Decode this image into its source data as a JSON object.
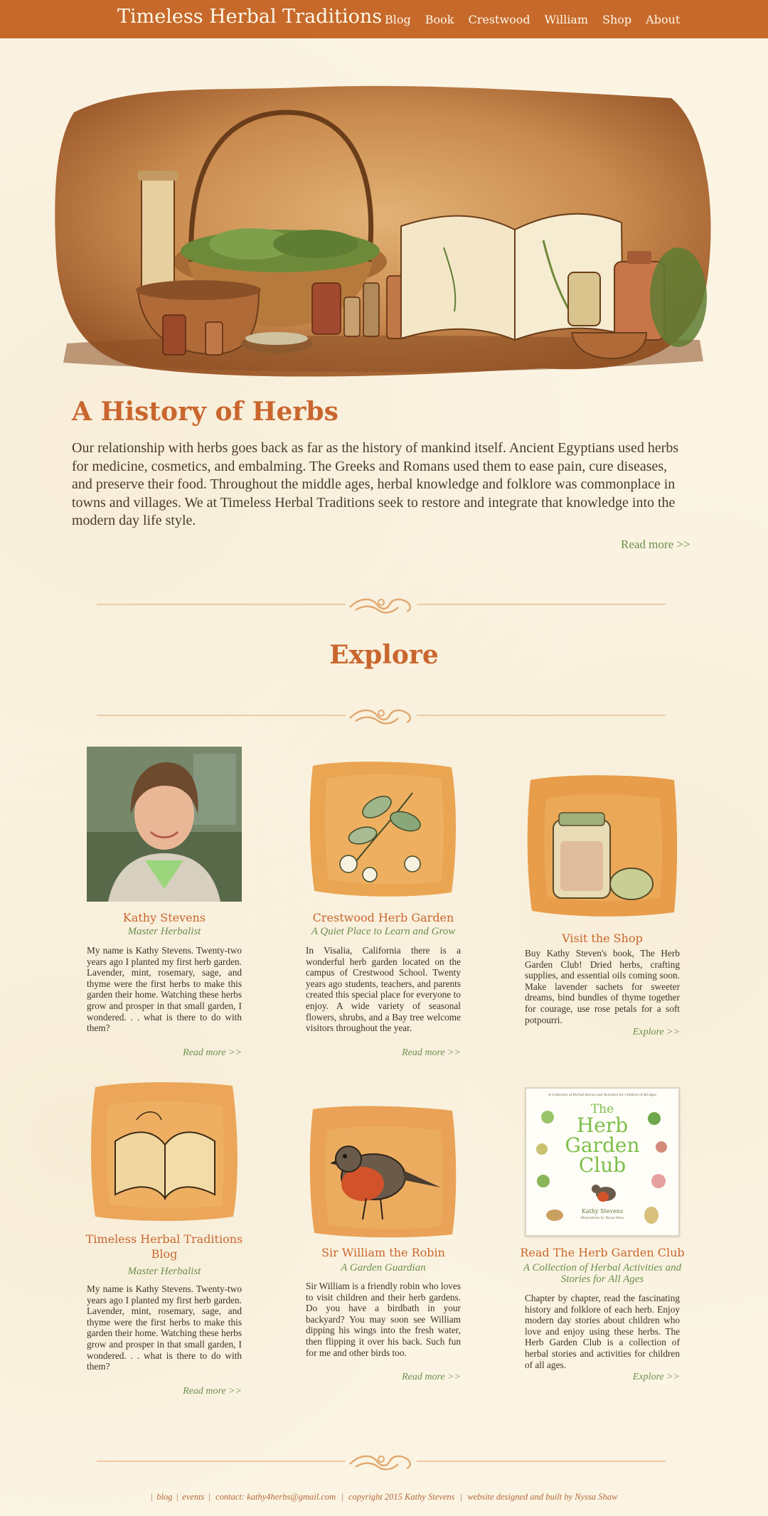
{
  "nav": {
    "brand": "Timeless Herbal Traditions",
    "links": [
      "Blog",
      "Book",
      "Crestwood",
      "William",
      "Shop",
      "About"
    ]
  },
  "history": {
    "title": "A History of Herbs",
    "text": "Our relationship with herbs goes back as far as the history of mankind itself. Ancient Egyptians used herbs for medicine, cosmetics, and embalming. The Greeks and Romans used them to ease pain, cure diseases, and preserve their food. Throughout the middle ages, herbal knowledge and folklore was commonplace in towns and villages. We at Timeless Herbal Traditions seek to restore and integrate that knowledge into the modern day life style.",
    "read_more": "Read more >>"
  },
  "explore_title": "Explore",
  "cards": [
    {
      "title": "Kathy Stevens",
      "subtitle": "Master Herbalist",
      "text": "My name is Kathy Stevens. Twenty-two years ago I planted my first herb garden. Lavender, mint, rosemary, sage, and thyme were the first herbs to make this garden their home. Watching these herbs grow and prosper in that small garden, I wondered. . . what is there to do with them?",
      "more": "Read more >>"
    },
    {
      "title": "Crestwood Herb Garden",
      "subtitle": "A Quiet Place to Learn and Grow",
      "text": "In Visalia, California there is a wonderful herb garden located on the campus of Crestwood School. Twenty years ago students, teachers, and parents created this special place for everyone to enjoy. A wide variety of seasonal flowers, shrubs, and a Bay tree welcome visitors throughout the year.",
      "more": "Read more >>"
    },
    {
      "title": "Visit the Shop",
      "subtitle": "",
      "text": "Buy Kathy Steven's book, The Herb Garden Club! Dried herbs, crafting supplies, and essential oils coming soon. Make lavender sachets for sweeter dreams, bind bundles of thyme together for courage, use rose petals for a soft potpourri.",
      "more": "Explore >>"
    },
    {
      "title": "Timeless Herbal Traditions Blog",
      "subtitle": "Master Herbalist",
      "text": "My name is Kathy Stevens. Twenty-two years ago I planted my first herb garden. Lavender, mint, rosemary, sage, and thyme were the first herbs to make this garden their home. Watching these herbs grow and prosper in that small garden, I wondered. . . what is there to do with them?",
      "more": "Read more >>"
    },
    {
      "title": "Sir William the Robin",
      "subtitle": "A Garden Guardian",
      "text": "Sir William is a friendly robin who loves to visit children and their herb gardens. Do you have a birdbath in your backyard? You may soon see William dipping his wings into the fresh water, then flipping it over his back. Such fun for me and other birds too.",
      "more": "Read more >>"
    },
    {
      "title": "Read The Herb Garden Club",
      "subtitle": "A Collection of Herbal Activities and Stories for All Ages",
      "text": "Chapter by chapter, read the fascinating history and folklore of each herb. Enjoy modern day stories about children who love and enjoy using these herbs. The Herb Garden Club is a collection of herbal stories and activities for children of all ages.",
      "more": "Explore >>"
    }
  ],
  "book_cover": {
    "tagline": "A Collection of Herbal Stories and Activities for Children of All Ages",
    "title_line1": "The",
    "title_line2": "Herb",
    "title_line3": "Garden",
    "title_line4": "Club",
    "author": "Kathy Stevens",
    "illustrator": "Illustrations by Nyssa Shaw"
  },
  "footer": {
    "items": [
      "blog",
      "events",
      "contact: kathy4herbs@gmail.com",
      "copyright 2015 Kathy Stevens",
      "website designed and built by Nyssa Shaw"
    ]
  },
  "colors": {
    "nav_bg": "#c6692a",
    "heading": "#c9662e",
    "link_green": "#6d8f4f",
    "page_bg": "#fbf4e3"
  }
}
